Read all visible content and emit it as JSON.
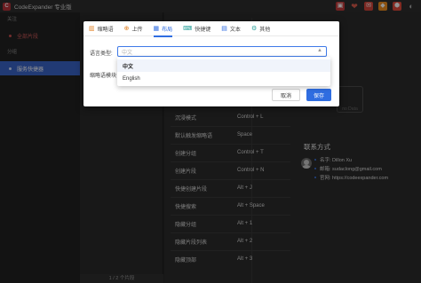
{
  "app": {
    "title": "CodeExpander 专业版",
    "logo_letter": "C"
  },
  "window_buttons": [
    "▣",
    "❤",
    "✉",
    "◆",
    "⬢",
    "◐"
  ],
  "sidebar": {
    "section_follow": "关注",
    "item_all": "全部片段",
    "section_group": "分组",
    "item_active": "服务快捷器"
  },
  "snippet_footer": "1 / 2 个片段",
  "shortcuts": [
    {
      "label": "沉浸模式",
      "value": "Control + L"
    },
    {
      "label": "默认触发缩略语",
      "value": "Space"
    },
    {
      "label": "创建分组",
      "value": "Control + T"
    },
    {
      "label": "创建片段",
      "value": "Control + N"
    },
    {
      "label": "快捷创建片段",
      "value": "Alt + J"
    },
    {
      "label": "快捷搜索",
      "value": "Alt + Space"
    },
    {
      "label": "隐藏分组",
      "value": "Alt + 1"
    },
    {
      "label": "隐藏片段列表",
      "value": "Alt + 2"
    },
    {
      "label": "隐藏顶部",
      "value": "Alt + 3"
    }
  ],
  "contact": {
    "title": "联系方式",
    "name": "名字: Dillon Xu",
    "email": "邮箱: sudaclong@gmail.com",
    "website": "官网: https://codeexpander.com"
  },
  "partial_card_text": "no Data",
  "dialog": {
    "tabs": [
      {
        "icon": "▥",
        "label": "缩略语",
        "color": "#e07b1a"
      },
      {
        "icon": "⊕",
        "label": "上传",
        "color": "#e07b1a"
      },
      {
        "icon": "▦",
        "label": "布局",
        "color": "#2f6de1"
      },
      {
        "icon": "⌨",
        "label": "快捷键",
        "color": "#2aa19b"
      },
      {
        "icon": "▤",
        "label": "文本",
        "color": "#2f6de1"
      },
      {
        "icon": "⚙",
        "label": "其他",
        "color": "#2aa19b"
      }
    ],
    "active_tab": 2,
    "language_label": "语言类型:",
    "language_value": "中文",
    "second_label": "缩略语模块",
    "cancel_label": "取消",
    "save_label": "保存"
  },
  "dropdown": {
    "options": [
      "中文",
      "English"
    ],
    "selected_index": 0
  },
  "colors": {
    "accent": "#2f6de1",
    "sidebar_active": "#3a64c8",
    "danger": "#c94e4e"
  }
}
